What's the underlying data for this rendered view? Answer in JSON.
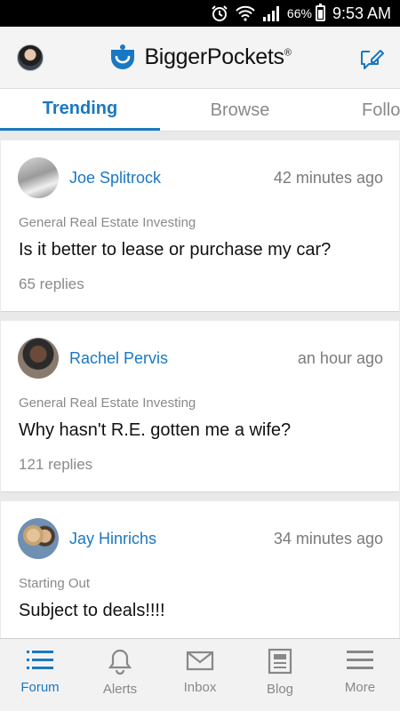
{
  "status_bar": {
    "battery": "66%",
    "time": "9:53 AM",
    "icons": [
      "alarm-icon",
      "wifi-icon",
      "signal-icon",
      "battery-icon"
    ]
  },
  "header": {
    "brand": "BiggerPockets",
    "brand_mark": "®",
    "compose_icon": "compose-icon",
    "accent": "#1a78c2"
  },
  "tabs": [
    "Trending",
    "Browse",
    "Follo"
  ],
  "posts": [
    {
      "author": "Joe Splitrock",
      "time": "42 minutes ago",
      "category": "General Real Estate Investing",
      "title": "Is it better to lease or purchase my car?",
      "replies": "65 replies"
    },
    {
      "author": "Rachel Pervis",
      "time": "an hour ago",
      "category": "General Real Estate Investing",
      "title": "Why hasn't R.E. gotten me a wife?",
      "replies": "121 replies"
    },
    {
      "author": "Jay Hinrichs",
      "time": "34 minutes ago",
      "category": "Starting Out",
      "title": "Subject to deals!!!!",
      "replies": ""
    }
  ],
  "nav": [
    {
      "label": "Forum",
      "icon": "list-icon"
    },
    {
      "label": "Alerts",
      "icon": "bell-icon"
    },
    {
      "label": "Inbox",
      "icon": "mail-icon"
    },
    {
      "label": "Blog",
      "icon": "blog-icon"
    },
    {
      "label": "More",
      "icon": "menu-icon"
    }
  ]
}
